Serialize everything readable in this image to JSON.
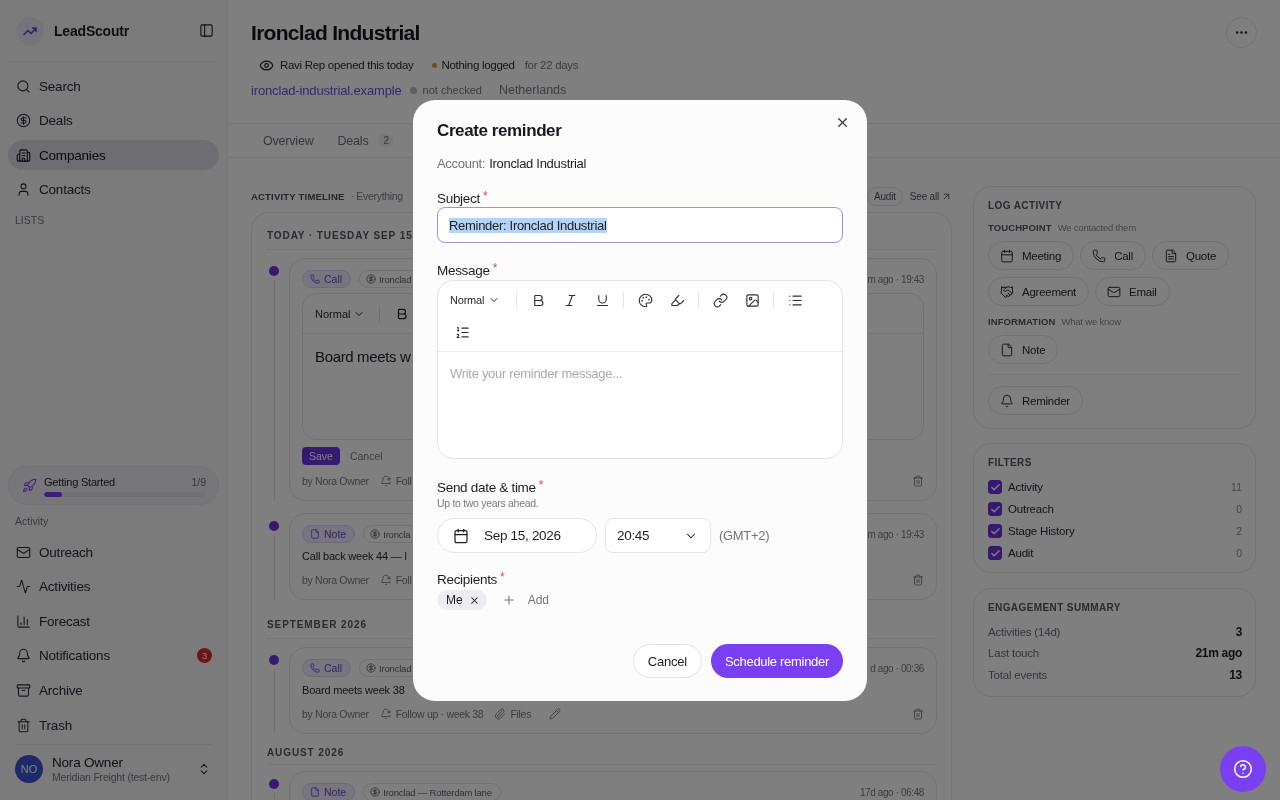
{
  "sidebar": {
    "brand": "LeadScoutr",
    "nav": [
      {
        "kind": "search",
        "label": "Search",
        "selected": false
      },
      {
        "kind": "deals",
        "label": "Deals",
        "selected": false
      },
      {
        "kind": "companies",
        "label": "Companies",
        "selected": true
      },
      {
        "kind": "contacts",
        "label": "Contacts",
        "selected": false
      }
    ],
    "lists_heading": "LISTS",
    "getting_started": {
      "label": "Getting Started",
      "progress": "1/9",
      "level": 0.11
    },
    "activity_heading": "Activity",
    "activity_nav": [
      {
        "kind": "outreach",
        "label": "Outreach",
        "selected": false
      },
      {
        "kind": "activities",
        "label": "Activities",
        "selected": false
      },
      {
        "kind": "forecast",
        "label": "Forecast",
        "selected": false
      },
      {
        "kind": "notifications",
        "label": "Notifications",
        "selected": false,
        "badge": "3"
      },
      {
        "kind": "archive",
        "label": "Archive",
        "selected": false
      },
      {
        "kind": "trash",
        "label": "Trash",
        "selected": false
      }
    ],
    "user": {
      "initials": "NO",
      "name": "Nora Owner",
      "org": "Meridian Freight (test-env)"
    }
  },
  "header": {
    "title": "Ironclad Industrial",
    "viewed": "Ravi Rep opened this today",
    "log_status": "Nothing logged",
    "log_status_detail": "for 22 days",
    "domain": "ironclad-industrial.example",
    "domain_check": "not checked",
    "country": "Netherlands"
  },
  "tabs": [
    {
      "label": "Overview",
      "selected": false
    },
    {
      "label": "Deals",
      "count": "2",
      "selected": false
    }
  ],
  "timeline": {
    "heading": "ACTIVITY TIMELINE",
    "subheading": "· Everything",
    "filters": [
      {
        "label": "Audit",
        "selected": false
      }
    ],
    "see_all": "See all",
    "groups": [
      {
        "label": "TODAY · TUESDAY SEP 15",
        "entries": [
          {
            "kind": "editing",
            "tag": {
              "kind": "call",
              "label": "Call"
            },
            "account": "Ironclad",
            "time": "m ago · 19:43",
            "editor": {
              "format": "Normal",
              "value": "Board meets w",
              "save": "Save",
              "cancel": "Cancel"
            },
            "author": "by Nora Owner",
            "follow_up": "Foll"
          },
          {
            "kind": "entry",
            "tag": {
              "kind": "note",
              "label": "Note"
            },
            "account": "Ironcla",
            "time": "m ago · 19:43",
            "body": "Call back week 44 — l",
            "author": "by Nora Owner",
            "follow_up": "Foll"
          }
        ]
      },
      {
        "label": "SEPTEMBER 2026",
        "entries": [
          {
            "kind": "entry",
            "tag": {
              "kind": "call",
              "label": "Call"
            },
            "account": "Ironclad",
            "time": "d ago · 00:36",
            "body": "Board meets week 38",
            "author": "by Nora Owner",
            "follow_up": "Follow up · week 38",
            "files": "Files",
            "editable": true
          }
        ]
      },
      {
        "label": "AUGUST 2026",
        "entries": [
          {
            "kind": "entry",
            "tag": {
              "kind": "note",
              "label": "Note"
            },
            "account": "Ironclad — Rotterdam lane",
            "time": "17d ago · 06:48"
          }
        ]
      }
    ]
  },
  "log_activity": {
    "heading": "LOG ACTIVITY",
    "sections": [
      {
        "heading": "TOUCHPOINT",
        "hint": "We contacted them",
        "actions": [
          {
            "kind": "meeting",
            "label": "Meeting"
          },
          {
            "kind": "call",
            "label": "Call"
          },
          {
            "kind": "quote",
            "label": "Quote"
          },
          {
            "kind": "agreement",
            "label": "Agreement"
          },
          {
            "kind": "email",
            "label": "Email"
          }
        ]
      },
      {
        "heading": "INFORMATION",
        "hint": "What we know",
        "actions": [
          {
            "kind": "note",
            "label": "Note"
          }
        ]
      }
    ],
    "reminder": {
      "kind": "reminder",
      "label": "Reminder"
    }
  },
  "filters": {
    "heading": "FILTERS",
    "items": [
      {
        "label": "Activity",
        "count": "11",
        "checked": true
      },
      {
        "label": "Outreach",
        "count": "0",
        "checked": true
      },
      {
        "label": "Stage History",
        "count": "2",
        "checked": true
      },
      {
        "label": "Audit",
        "count": "0",
        "checked": true
      }
    ]
  },
  "engagement": {
    "heading": "ENGAGEMENT SUMMARY",
    "rows": [
      {
        "label": "Activities (14d)",
        "value": "3"
      },
      {
        "label": "Last touch",
        "value": "21m ago"
      },
      {
        "label": "Total events",
        "value": "13"
      }
    ]
  },
  "modal": {
    "title": "Create reminder",
    "account_label": "Account:",
    "account": "Ironclad Industrial",
    "subject": {
      "label": "Subject",
      "required": "*",
      "value": "Reminder: Ironclad Industrial",
      "value_selected": true
    },
    "message": {
      "label": "Message",
      "required": "*",
      "format": "Normal",
      "placeholder": "Write your reminder message..."
    },
    "send": {
      "label": "Send date & time",
      "required": "*",
      "hint": "Up to two years ahead.",
      "date": "Sep 15, 2026",
      "time": "20:45",
      "timezone": "(GMT+2)"
    },
    "recipients": {
      "label": "Recipients",
      "required": "*",
      "chips": [
        "Me"
      ],
      "add": "Add"
    },
    "cancel": "Cancel",
    "submit": "Schedule reminder"
  }
}
